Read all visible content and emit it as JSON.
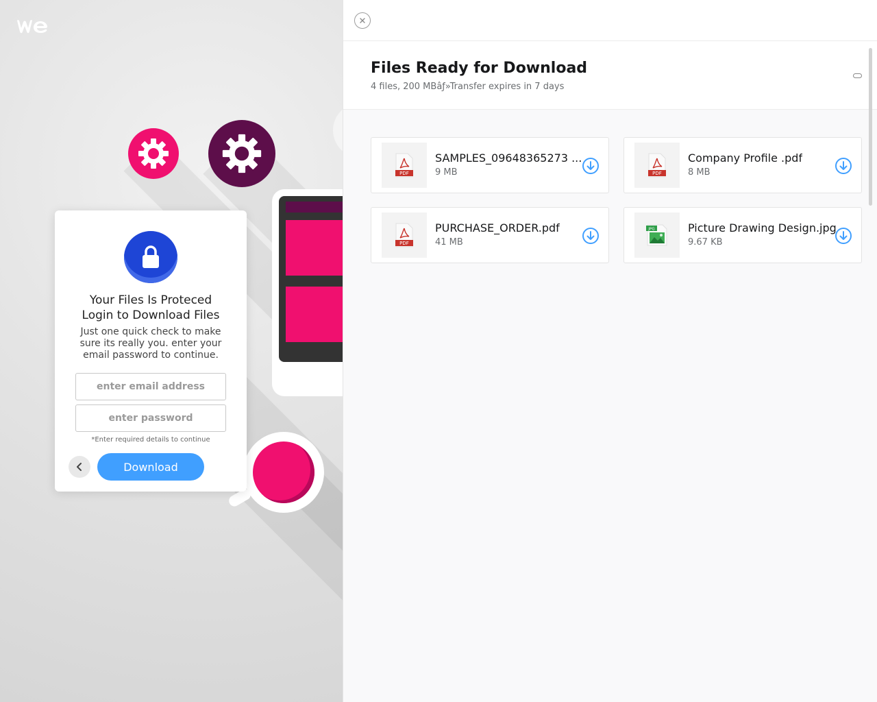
{
  "brand": {
    "logo_text": "we"
  },
  "login": {
    "title_line1": "Your Files Is Proteced",
    "title_line2": "Login to Download Files",
    "subtitle": "Just one quick check to make sure its really you. enter your email password to continue.",
    "email_placeholder": "enter email address",
    "password_placeholder": "enter password",
    "hint": "*Enter required details to continue",
    "download_label": "Download"
  },
  "panel": {
    "title": "Files Ready for Download",
    "meta": "4 files, 200 MBâƒ»Transfer expires in 7 days",
    "files": [
      {
        "name": "SAMPLES_09648365273 ...",
        "size": "9 MB",
        "type": "pdf",
        "icon": "pdf-file-icon"
      },
      {
        "name": "Company Profile .pdf",
        "size": "8 MB",
        "type": "pdf",
        "icon": "pdf-file-icon"
      },
      {
        "name": "PURCHASE_ORDER.pdf",
        "size": "41 MB",
        "type": "pdf",
        "icon": "pdf-file-icon"
      },
      {
        "name": "Picture Drawing Design.jpg",
        "size": "9.67 KB",
        "type": "jpg",
        "icon": "jpg-file-icon"
      }
    ]
  },
  "colors": {
    "accent_blue": "#409fff",
    "brand_pink": "#f0106f",
    "brand_purple": "#5d0e4a",
    "lock_blue": "#1e45d6",
    "pdf_red": "#c8342c"
  }
}
